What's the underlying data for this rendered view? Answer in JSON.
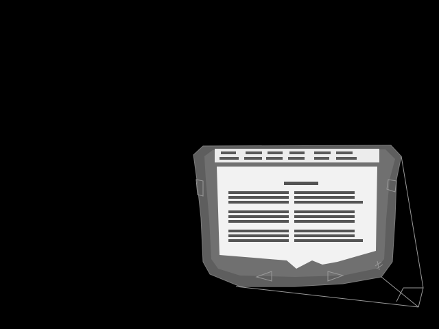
{
  "colors": {
    "background": "#000000",
    "device_body": "#5e5e5e",
    "device_bezel": "#808080",
    "screen": "#f2f2f2",
    "outline": "#9a9a9a",
    "glyph_ink": "#222222"
  },
  "icons": {
    "left_side_button": "rect-outline",
    "right_side_button": "rect-outline",
    "prev_nav": "left-triangle-outline",
    "next_nav": "right-triangle-outline",
    "stylus": "stylus-line"
  }
}
